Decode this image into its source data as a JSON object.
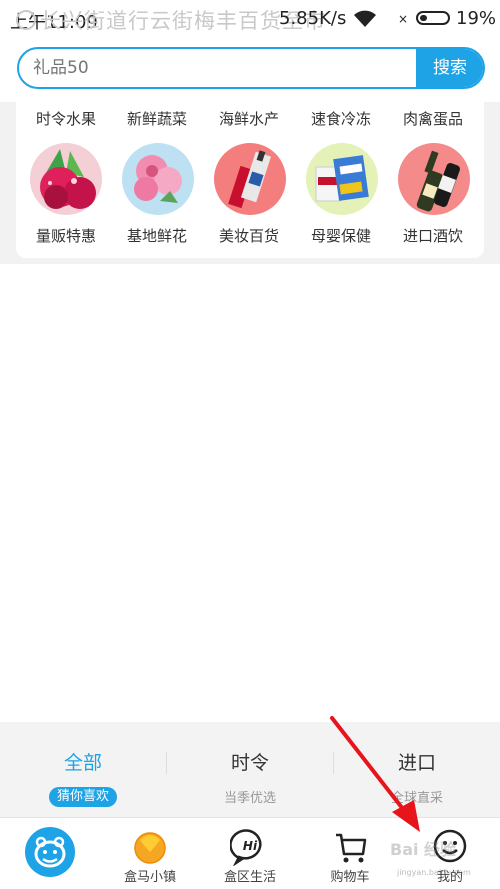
{
  "status_bar": {
    "time": "上午11:09",
    "location_overlay": "长兴街道行云街梅丰百货至市",
    "network_speed": "5.85K/s",
    "battery_percent": "19%",
    "wifi_icon": "wifi-icon",
    "battery_icon": "battery-icon"
  },
  "search": {
    "placeholder": "礼品50",
    "button_label": "搜索"
  },
  "categories": {
    "top_row": [
      "时令水果",
      "新鲜蔬菜",
      "海鲜水产",
      "速食冷冻",
      "肉禽蛋品"
    ],
    "bottom_row": [
      {
        "label": "量贩特惠",
        "image": "dragon-fruit"
      },
      {
        "label": "基地鲜花",
        "image": "flowers"
      },
      {
        "label": "美妆百货",
        "image": "cosmetics"
      },
      {
        "label": "母婴保健",
        "image": "milk-powder"
      },
      {
        "label": "进口酒饮",
        "image": "wine-bottle"
      }
    ]
  },
  "tabs": [
    {
      "title": "全部",
      "subtitle": "猜你喜欢",
      "active": true
    },
    {
      "title": "时令",
      "subtitle": "当季优选",
      "active": false
    },
    {
      "title": "进口",
      "subtitle": "全球直采",
      "active": false
    }
  ],
  "bottom_nav": [
    {
      "label": "",
      "icon": "hippo-home-icon"
    },
    {
      "label": "盒马小镇",
      "icon": "town-icon"
    },
    {
      "label": "盒区生活",
      "icon": "hi-chat-icon"
    },
    {
      "label": "购物车",
      "icon": "cart-icon"
    },
    {
      "label": "我的",
      "icon": "smiley-profile-icon"
    }
  ],
  "watermark": {
    "text": "Bai 经验",
    "sub": "jingyan.baidu.com"
  },
  "colors": {
    "accent": "#1ea3e6",
    "annotation_arrow": "#e8141b"
  }
}
